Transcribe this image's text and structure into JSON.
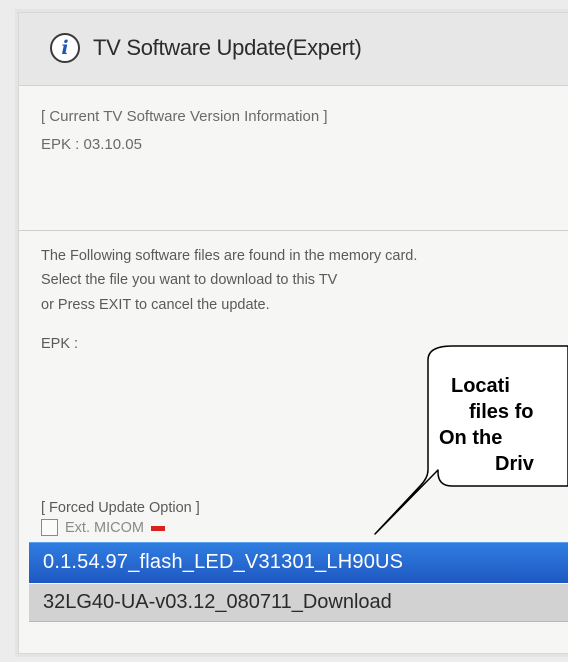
{
  "header": {
    "title": "TV Software Update(Expert)",
    "icon": "info-icon"
  },
  "current_version": {
    "heading": "[ Current TV Software Version Information ]",
    "epk": "EPK : 03.10.05"
  },
  "message": {
    "line1": "The Following software files are found in the memory card.",
    "line2": "Select the file you want to download to this TV",
    "line3": "or Press EXIT to cancel the update.",
    "epk": "EPK :"
  },
  "forced_update": {
    "heading": "[ Forced Update Option ]",
    "checkbox_label": "Ext. MICOM",
    "checked": false
  },
  "files": {
    "selected": "0.1.54.97_flash_LED_V31301_LH90US",
    "other": "32LG40-UA-v03.12_080711_Download"
  },
  "callout": {
    "line1": "Locati",
    "line2": "files fo",
    "line3": "On the",
    "line4": "Driv"
  },
  "colors": {
    "selected_bg": "#2b6fd6",
    "panel_bg": "#f6f6f4",
    "flag": "#d9221f"
  }
}
